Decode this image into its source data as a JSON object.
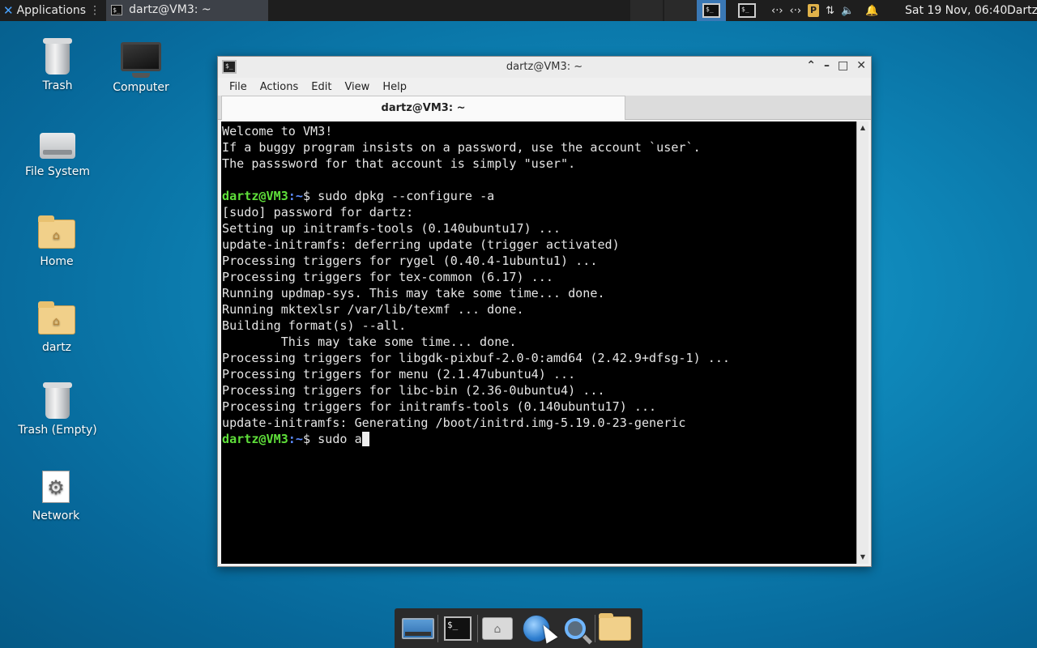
{
  "top_panel": {
    "applications_label": "Applications",
    "task_label": "dartz@VM3: ~",
    "clock": "Sat 19 Nov, 06:40",
    "user": "Dartz"
  },
  "desktop_icons": [
    {
      "label": "Trash"
    },
    {
      "label": "Computer"
    },
    {
      "label": "File System"
    },
    {
      "label": "Home"
    },
    {
      "label": "dartz"
    },
    {
      "label": "Trash (Empty)"
    },
    {
      "label": "Network"
    }
  ],
  "window": {
    "title": "dartz@VM3: ~",
    "menu": [
      "File",
      "Actions",
      "Edit",
      "View",
      "Help"
    ],
    "tab_label": "dartz@VM3: ~",
    "terminal_lines": [
      "Welcome to VM3!",
      "If a buggy program insists on a password, use the account `user`.",
      "The passsword for that account is simply \"user\".",
      "",
      "",
      "[sudo] password for dartz:",
      "Setting up initramfs-tools (0.140ubuntu17) ...",
      "update-initramfs: deferring update (trigger activated)",
      "Processing triggers for rygel (0.40.4-1ubuntu1) ...",
      "Processing triggers for tex-common (6.17) ...",
      "Running updmap-sys. This may take some time... done.",
      "Running mktexlsr /var/lib/texmf ... done.",
      "Building format(s) --all.",
      "        This may take some time... done.",
      "Processing triggers for libgdk-pixbuf-2.0-0:amd64 (2.42.9+dfsg-1) ...",
      "Processing triggers for menu (2.1.47ubuntu4) ...",
      "Processing triggers for libc-bin (2.36-0ubuntu4) ...",
      "Processing triggers for initramfs-tools (0.140ubuntu17) ...",
      "update-initramfs: Generating /boot/initrd.img-5.19.0-23-generic"
    ],
    "prompt_user": "dartz@VM3",
    "prompt_path": ":~",
    "prompt_symbol": "$ ",
    "command_1": "sudo dpkg --configure -a",
    "command_2": "sudo a"
  },
  "colors": {
    "prompt_user": "#5fdf3a",
    "prompt_path": "#5c8cff",
    "terminal_bg": "#000000",
    "terminal_fg": "#e5e5e5"
  }
}
